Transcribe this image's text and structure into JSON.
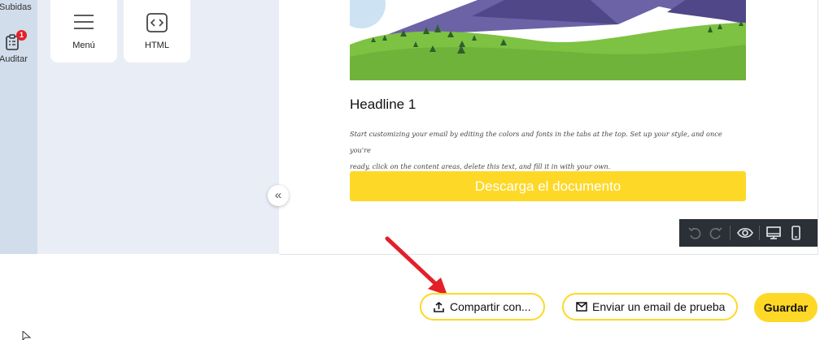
{
  "sidebar": {
    "items": [
      {
        "label": "Subidas"
      },
      {
        "label": "Auditar",
        "badge": "1"
      }
    ]
  },
  "blocks": [
    {
      "label": "Menú",
      "icon": "menu-icon"
    },
    {
      "label": "HTML",
      "icon": "code-icon"
    }
  ],
  "email": {
    "headline": "Headline 1",
    "body_line1": "Start customizing your email by editing the colors and fonts in the tabs at the top. Set up your style, and once you're",
    "body_line2": "ready, click on the content areas, delete this text, and fill it in with your own.",
    "cta_label": "Descarga el documento"
  },
  "collapse_label": "«",
  "toolbar_icons": [
    "undo-icon",
    "redo-icon",
    "preview-icon",
    "desktop-icon",
    "mobile-icon"
  ],
  "actions": {
    "share_label": "Compartir con...",
    "test_email_label": "Enviar un email de prueba",
    "save_label": "Guardar"
  },
  "colors": {
    "accent": "#fed826",
    "badge": "#e3202a",
    "annotation_arrow": "#e3202a"
  }
}
